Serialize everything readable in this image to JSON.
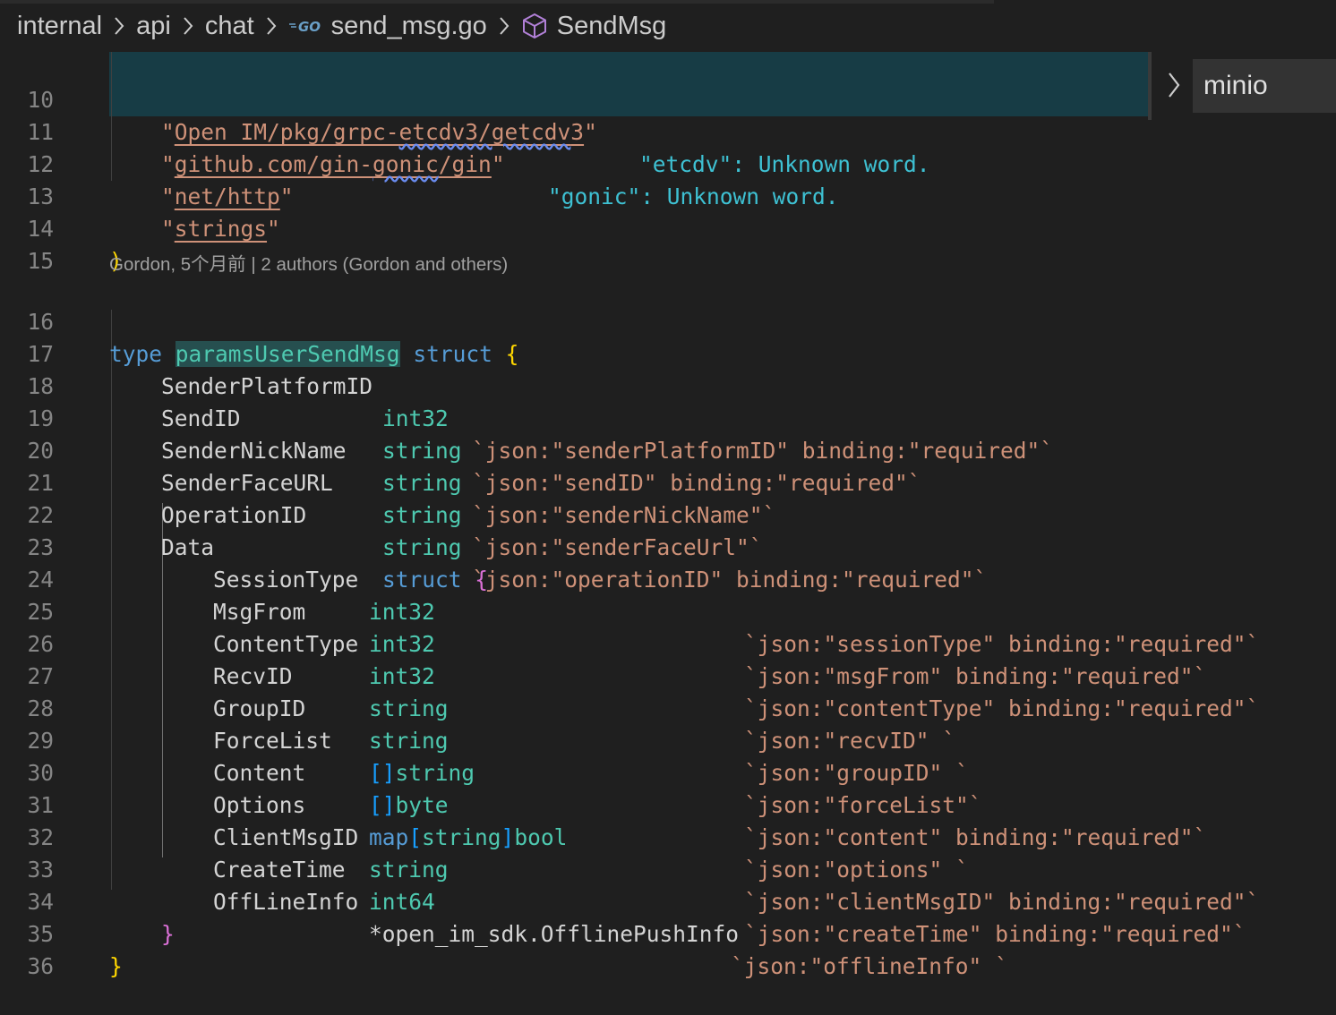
{
  "breadcrumb": {
    "items": [
      "internal",
      "api",
      "chat",
      "send_msg.go",
      "SendMsg"
    ],
    "file_icon": "go-file-icon",
    "symbol_icon": "method-cube-icon"
  },
  "outline_peek": {
    "label": "minio"
  },
  "codelens": "Gordon, 5个月前 | 2 authors (Gordon and others)",
  "lines": {
    "l10": {
      "num": "10",
      "open": "\"",
      "path": "Open_IM/pkg/grpc-etcdv3/getcdv3",
      "close": "\"",
      "diag": "\"etcdv\": Unknown word."
    },
    "l11": {
      "num": "11",
      "open": "\"",
      "path": "github.com/gin-gonic/gin",
      "close": "\"",
      "diag": "\"gonic\": Unknown word."
    },
    "l12": {
      "num": "12",
      "open": "\"",
      "path": "net/http",
      "close": "\""
    },
    "l13": {
      "num": "13",
      "open": "\"",
      "path": "strings",
      "close": "\""
    },
    "l14": {
      "num": "14",
      "paren": ")"
    },
    "l15": {
      "num": "15"
    },
    "l16": {
      "num": "16",
      "kw_type": "type",
      "name": "paramsUserSendMsg",
      "kw_struct": "struct",
      "brace": "{"
    },
    "l17": {
      "num": "17",
      "field": "SenderPlatformID",
      "type": "int32",
      "tag": "`json:\"senderPlatformID\" binding:\"required\"`"
    },
    "l18": {
      "num": "18",
      "field": "SendID",
      "type": "string",
      "tag": "`json:\"sendID\" binding:\"required\"`"
    },
    "l19": {
      "num": "19",
      "field": "SenderNickName",
      "type": "string",
      "tag": "`json:\"senderNickName\"`"
    },
    "l20": {
      "num": "20",
      "field": "SenderFaceURL",
      "type": "string",
      "tag": "`json:\"senderFaceUrl\"`"
    },
    "l21": {
      "num": "21",
      "field": "OperationID",
      "type": "string",
      "tag": "`json:\"operationID\" binding:\"required\"`"
    },
    "l22": {
      "num": "22",
      "field": "Data",
      "kw_struct": "struct",
      "brace": "{"
    },
    "l23": {
      "num": "23",
      "field": "SessionType",
      "type": "int32",
      "tag": "`json:\"sessionType\" binding:\"required\"`"
    },
    "l24": {
      "num": "24",
      "field": "MsgFrom",
      "type": "int32",
      "tag": "`json:\"msgFrom\" binding:\"required\"`"
    },
    "l25": {
      "num": "25",
      "field": "ContentType",
      "type": "int32",
      "tag": "`json:\"contentType\" binding:\"required\"`"
    },
    "l26": {
      "num": "26",
      "field": "RecvID",
      "type": "string",
      "tag": "`json:\"recvID\" `"
    },
    "l27": {
      "num": "27",
      "field": "GroupID",
      "type": "string",
      "tag": "`json:\"groupID\" `"
    },
    "l28": {
      "num": "28",
      "field": "ForceList",
      "brackets": "[]",
      "type": "string",
      "tag": "`json:\"forceList\"`"
    },
    "l29": {
      "num": "29",
      "field": "Content",
      "brackets": "[]",
      "type": "byte",
      "tag": "`json:\"content\" binding:\"required\"`"
    },
    "l30": {
      "num": "30",
      "field": "Options",
      "map": "map",
      "lbr": "[",
      "key": "string",
      "rbr": "]",
      "type": "bool",
      "tag": "`json:\"options\" `"
    },
    "l31": {
      "num": "31",
      "field": "ClientMsgID",
      "type": "string",
      "tag": "`json:\"clientMsgID\" binding:\"required\"`"
    },
    "l32": {
      "num": "32",
      "field": "CreateTime",
      "type": "int64",
      "tag": "`json:\"createTime\" binding:\"required\"`"
    },
    "l33": {
      "num": "33",
      "field": "OffLineInfo",
      "ptr": "*open_im_sdk.OfflinePushInfo",
      "tag": "`json:\"offlineInfo\" `"
    },
    "l34": {
      "num": "34",
      "brace": "}"
    },
    "l35": {
      "num": "35",
      "brace": "}"
    },
    "l36": {
      "num": "36"
    }
  }
}
